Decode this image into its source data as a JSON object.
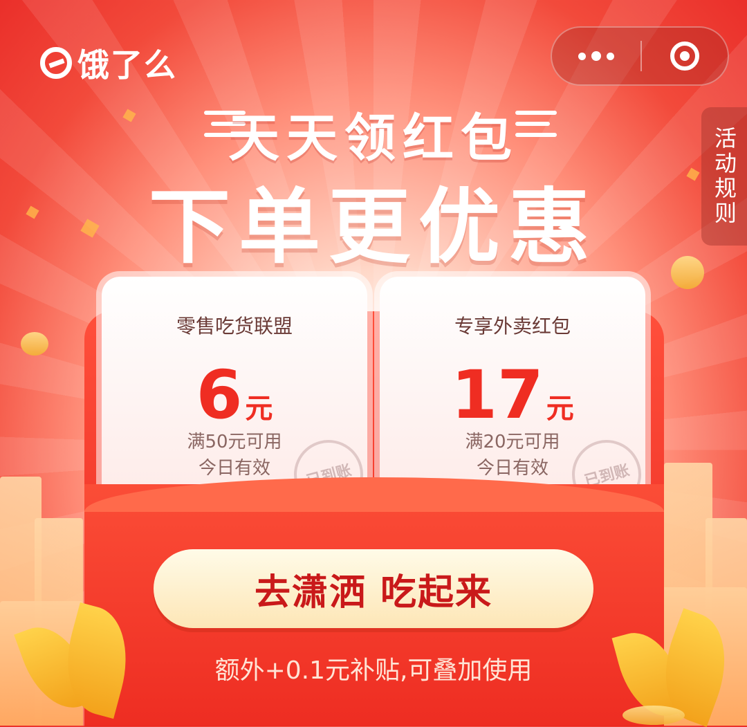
{
  "brand": {
    "logo_text": "饿了么"
  },
  "capsule": {
    "more_icon": "more-dots-icon",
    "close_icon": "mini-program-close-icon"
  },
  "rules_tab": {
    "label": "活动规则"
  },
  "headline": {
    "line1": "天天领红包",
    "line2": "下单更优惠"
  },
  "coupons": [
    {
      "title": "零售吃货联盟",
      "amount": "6",
      "unit": "元",
      "condition": "满50元可用",
      "validity": "今日有效",
      "stamp": "已到账"
    },
    {
      "title": "专享外卖红包",
      "amount": "17",
      "unit": "元",
      "condition": "满20元可用",
      "validity": "今日有效",
      "stamp": "已到账"
    }
  ],
  "cta": {
    "label": "去潇洒 吃起来"
  },
  "footer": {
    "subsidy_text": "额外+0.1元补贴,可叠加使用"
  },
  "colors": {
    "primary_red": "#ef2d22",
    "cta_text": "#c9191a",
    "cta_bg": "#fdf1cf"
  }
}
